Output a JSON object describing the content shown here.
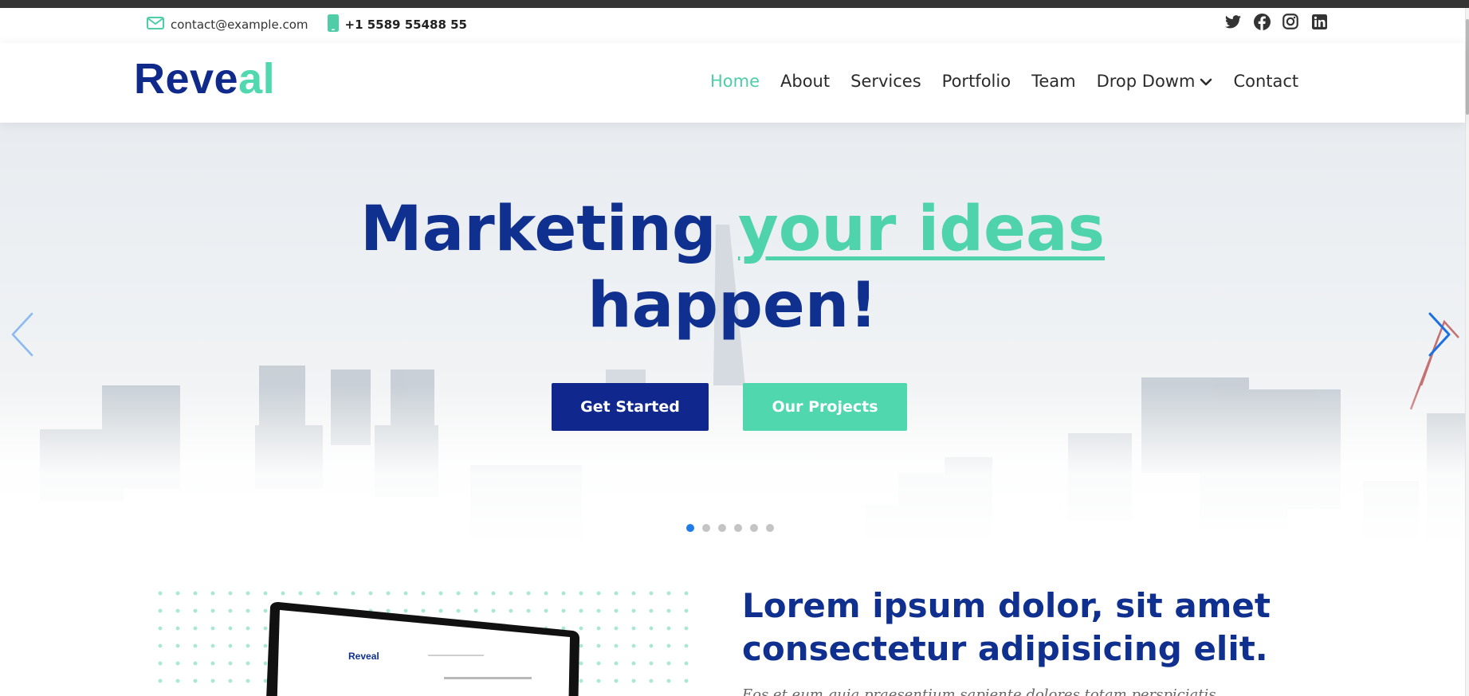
{
  "topbar": {
    "email": "contact@example.com",
    "phone": "+1 5589 55488 55",
    "icons": [
      "envelope-icon",
      "phone-icon"
    ],
    "social": [
      {
        "name": "twitter-icon"
      },
      {
        "name": "facebook-icon"
      },
      {
        "name": "instagram-icon"
      },
      {
        "name": "linkedin-icon"
      }
    ]
  },
  "brand": {
    "logo_main": "Reve",
    "logo_accent": "al"
  },
  "nav": {
    "items": [
      {
        "label": "Home",
        "active": true
      },
      {
        "label": "About"
      },
      {
        "label": "Services"
      },
      {
        "label": "Portfolio"
      },
      {
        "label": "Team"
      },
      {
        "label": "Drop Dowm",
        "dropdown": true
      },
      {
        "label": "Contact"
      }
    ]
  },
  "hero": {
    "title_part1": "Marketing",
    "title_highlight": "your ideas",
    "title_part2": "happen!",
    "primary_button": "Get Started",
    "secondary_button": "Our Projects",
    "slides_count": 6,
    "active_slide": 1
  },
  "about": {
    "heading": "Lorem ipsum dolor, sit amet consectetur adipisicing elit.",
    "subtext": "Eos et eum quia praesentium sapiente dolores totam perspiciatis",
    "laptop_logo": "Reveal"
  },
  "colors": {
    "brand_navy": "#10308f",
    "brand_mint": "#50d7ae",
    "indicator_active": "#1f7be8"
  }
}
